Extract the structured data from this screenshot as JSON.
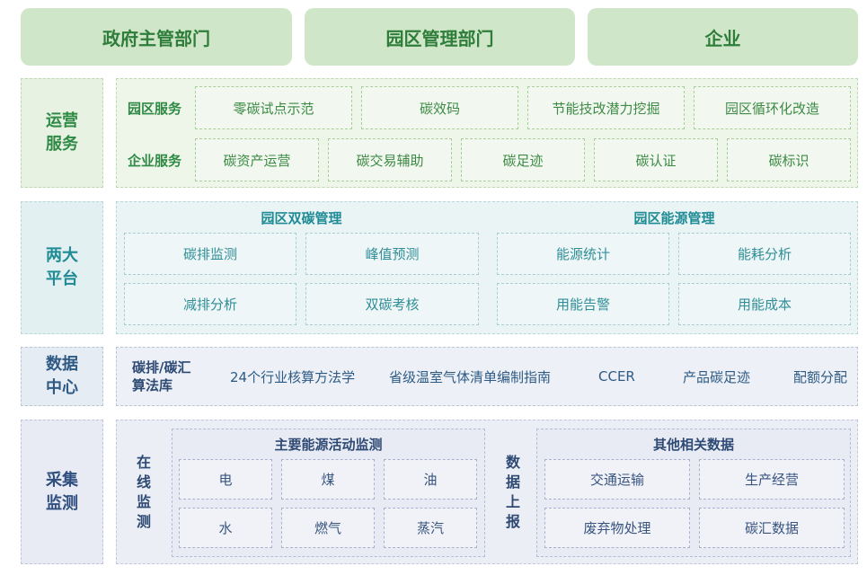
{
  "stakeholders": [
    "政府主管部门",
    "园区管理部门",
    "企业"
  ],
  "layers": {
    "ops": {
      "label": "运营\n服务",
      "park_label": "园区服务",
      "park_items": [
        "零碳试点示范",
        "碳效码",
        "节能技改潜力挖掘",
        "园区循环化改造"
      ],
      "ent_label": "企业服务",
      "ent_items": [
        "碳资产运营",
        "碳交易辅助",
        "碳足迹",
        "碳认证",
        "碳标识"
      ]
    },
    "platform": {
      "label": "两大\n平台",
      "left_title": "园区双碳管理",
      "left_items": [
        "碳排监测",
        "峰值预测",
        "减排分析",
        "双碳考核"
      ],
      "right_title": "园区能源管理",
      "right_items": [
        "能源统计",
        "能耗分析",
        "用能告警",
        "用能成本"
      ]
    },
    "data_center": {
      "label": "数据\n中心",
      "items": [
        "碳排/碳汇\n算法库",
        "24个行业核算方法学",
        "省级温室气体清单编制指南",
        "CCER",
        "产品碳足迹",
        "配额分配"
      ]
    },
    "collect": {
      "label": "采集\n监测",
      "online_label": "在\n线\n监\n测",
      "energy_title": "主要能源活动监测",
      "energy_items": [
        "电",
        "煤",
        "油",
        "水",
        "燃气",
        "蒸汽"
      ],
      "report_label": "数\n据\n上\n报",
      "other_title": "其他相关数据",
      "other_items": [
        "交通运输",
        "生产经营",
        "废弃物处理",
        "碳汇数据"
      ]
    }
  }
}
